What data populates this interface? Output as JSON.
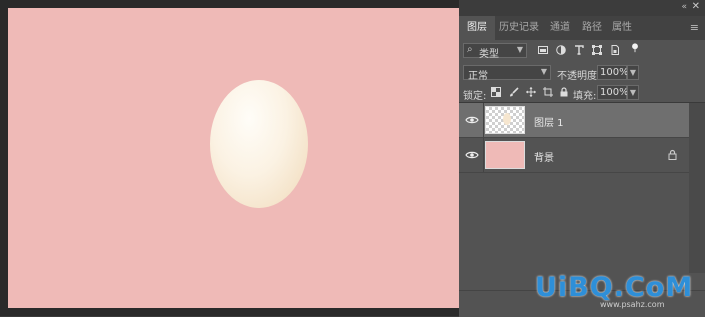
{
  "panel": {
    "tabs": [
      "图层",
      "历史记录",
      "通道",
      "路径",
      "属性"
    ],
    "active_tab": 0,
    "collapse_icon": "double-chevron-left-icon",
    "close_icon": "close-icon",
    "menu_icon": "panel-menu-icon"
  },
  "filter": {
    "kind_label": "类型",
    "icons": [
      "pixel-filter-icon",
      "adjustment-filter-icon",
      "type-filter-icon",
      "shape-filter-icon",
      "smart-object-filter-icon",
      "filter-toggle-icon"
    ]
  },
  "blend": {
    "mode": "正常",
    "opacity_label": "不透明度:",
    "opacity_value": "100%"
  },
  "lock": {
    "label": "锁定:",
    "icons": [
      "lock-transparent-icon",
      "lock-paint-icon",
      "lock-position-icon",
      "lock-artboard-icon",
      "lock-all-icon"
    ],
    "fill_label": "填充:",
    "fill_value": "100%"
  },
  "layers": [
    {
      "name": "图层 1",
      "visible": true,
      "selected": true,
      "locked": false
    },
    {
      "name": "背景",
      "visible": true,
      "selected": false,
      "locked": true
    }
  ],
  "canvas": {
    "background_color": "#efbab7",
    "egg_color": "#f6e7d2"
  },
  "watermark": {
    "text": "UiBQ.CoM",
    "sub": "www.psahz.com"
  }
}
